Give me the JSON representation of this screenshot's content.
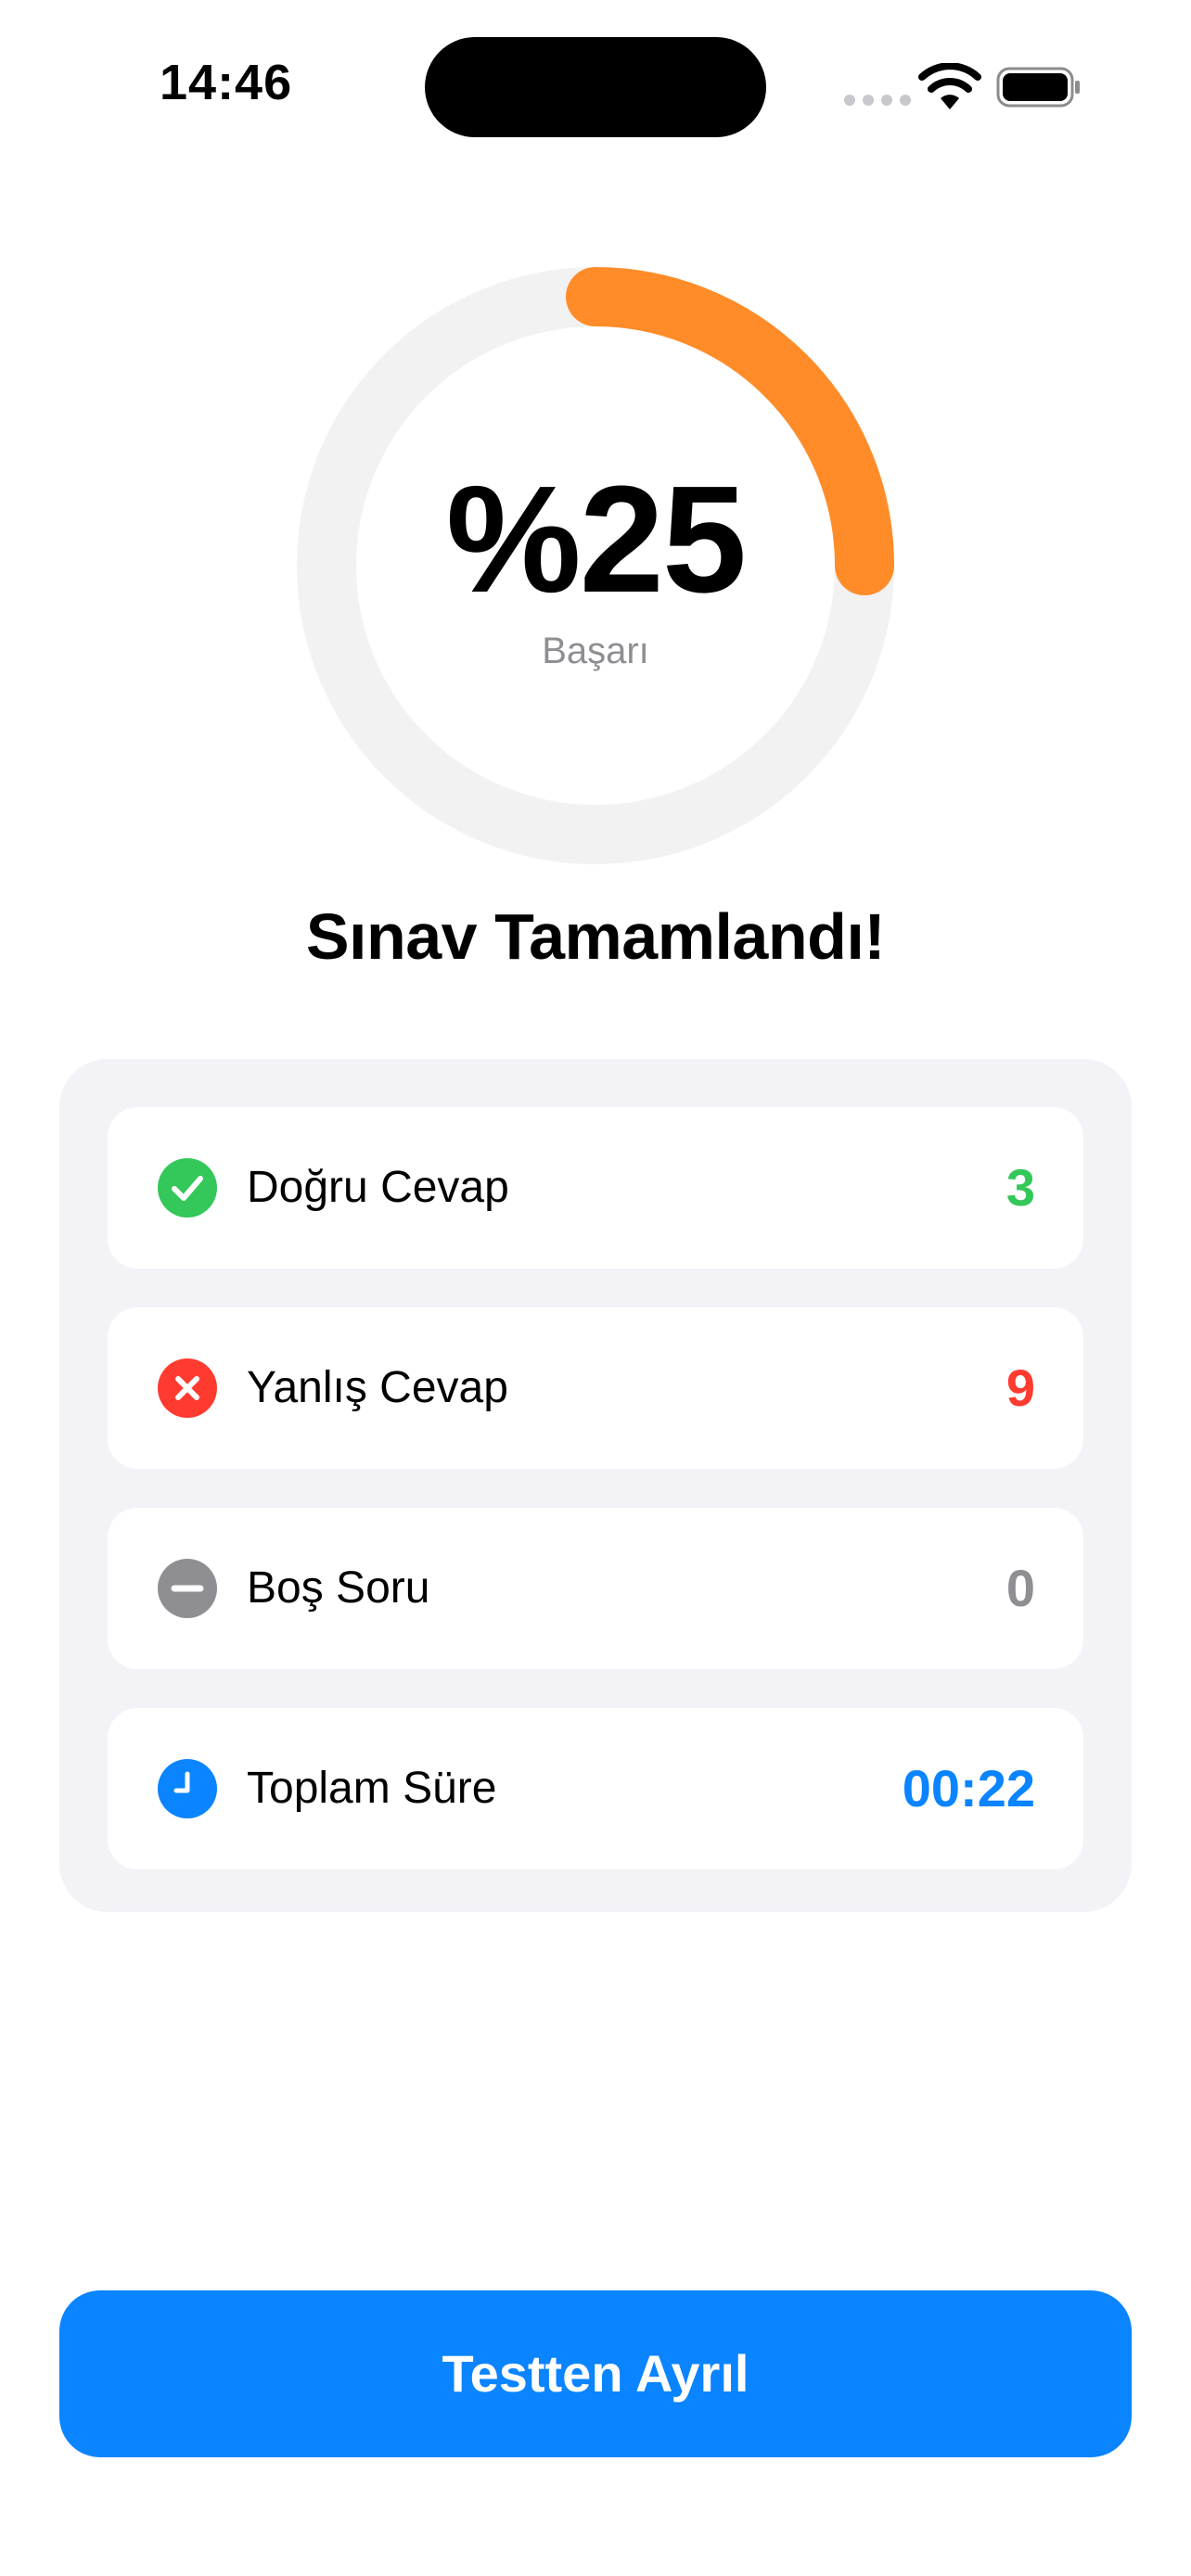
{
  "status_bar": {
    "time": "14:46"
  },
  "result": {
    "percent_text": "%25",
    "progress": 0.25,
    "label": "Başarı",
    "colors": {
      "track": "#f2f2f2",
      "progress": "#ff8c28"
    }
  },
  "title": "Sınav Tamamlandı!",
  "stats": [
    {
      "icon": "checkmark-circle-icon",
      "label": "Doğru Cevap",
      "value": "3",
      "color": "#34c759"
    },
    {
      "icon": "xmark-circle-icon",
      "label": "Yanlış Cevap",
      "value": "9",
      "color": "#ff3b30"
    },
    {
      "icon": "minus-circle-icon",
      "label": "Boş Soru",
      "value": "0",
      "color": "#8e8e93"
    },
    {
      "icon": "clock-icon",
      "label": "Toplam Süre",
      "value": "00:22",
      "color": "#0a84ff"
    }
  ],
  "leave_button": {
    "label": "Testten Ayrıl",
    "color": "#0a84ff"
  }
}
